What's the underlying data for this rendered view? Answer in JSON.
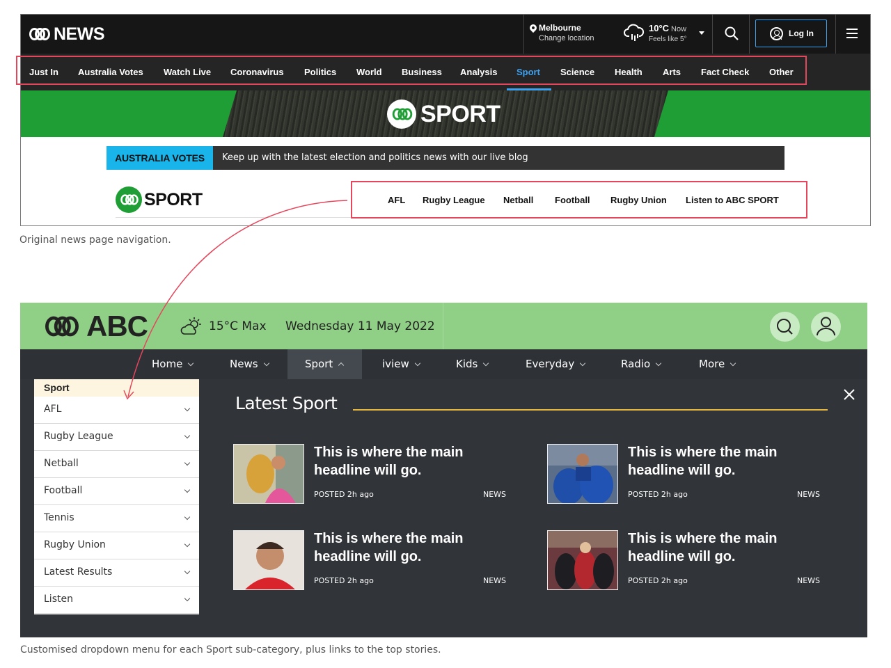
{
  "news_header": {
    "logo_text": "NEWS",
    "location_name": "Melbourne",
    "location_change": "Change location",
    "temperature": "10°C",
    "temperature_now": "Now",
    "feels_like": "Feels like 5°",
    "login_label": "Log In",
    "icons": [
      "pin-icon",
      "cloud-rain-icon",
      "caret-down-icon",
      "search-icon",
      "user-circle-icon",
      "hamburger-icon"
    ]
  },
  "news_nav": {
    "items": [
      "Just In",
      "Australia Votes",
      "Watch Live",
      "Coronavirus",
      "Politics",
      "World",
      "Business",
      "Analysis",
      "Sport",
      "Science",
      "Health",
      "Arts",
      "Fact Check",
      "Other"
    ],
    "active": "Sport"
  },
  "sport_banner": {
    "word": "SPORT"
  },
  "votes_bar": {
    "tag": "AUSTRALIA VOTES",
    "text": "Keep up with the latest election and politics news with our live blog"
  },
  "sport_subnav": {
    "logo_word": "SPORT",
    "items": [
      "AFL",
      "Rugby League",
      "Netball",
      "Football",
      "Rugby Union",
      "Listen to ABC SPORT"
    ]
  },
  "captions": {
    "top": "Original news page navigation.",
    "bottom": "Customised dropdown menu for each Sport sub-category, plus links to the top stories."
  },
  "abc_header": {
    "logo_text": "ABC",
    "temp": "15°C Max",
    "date": "Wednesday 11 May 2022",
    "icons": [
      "sun-cloud-icon",
      "search-icon",
      "user-icon"
    ]
  },
  "abc_nav": {
    "items": [
      "Home",
      "News",
      "Sport",
      "iview",
      "Kids",
      "Everyday",
      "Radio",
      "More"
    ],
    "active": "Sport"
  },
  "side_menu": {
    "heading": "Sport",
    "items": [
      "AFL",
      "Rugby League",
      "Netball",
      "Football",
      "Tennis",
      "Rugby Union",
      "Latest Results",
      "Listen"
    ]
  },
  "latest": {
    "title": "Latest Sport",
    "stories": [
      {
        "headline": "This is where the main headline will go.",
        "posted": "POSTED 2h ago",
        "tag": "NEWS"
      },
      {
        "headline": "This is where the main headline will go.",
        "posted": "POSTED 2h ago",
        "tag": "NEWS"
      },
      {
        "headline": "This is where the main headline will go.",
        "posted": "POSTED 2h ago",
        "tag": "NEWS"
      },
      {
        "headline": "This is where the main headline will go.",
        "posted": "POSTED 2h ago",
        "tag": "NEWS"
      }
    ]
  },
  "colors": {
    "accent_blue": "#3ea1f0",
    "sport_green": "#1e9e34",
    "abc_green": "#8fd086",
    "highlight_red": "#e4475c",
    "rule_gold": "#e6b53b"
  }
}
